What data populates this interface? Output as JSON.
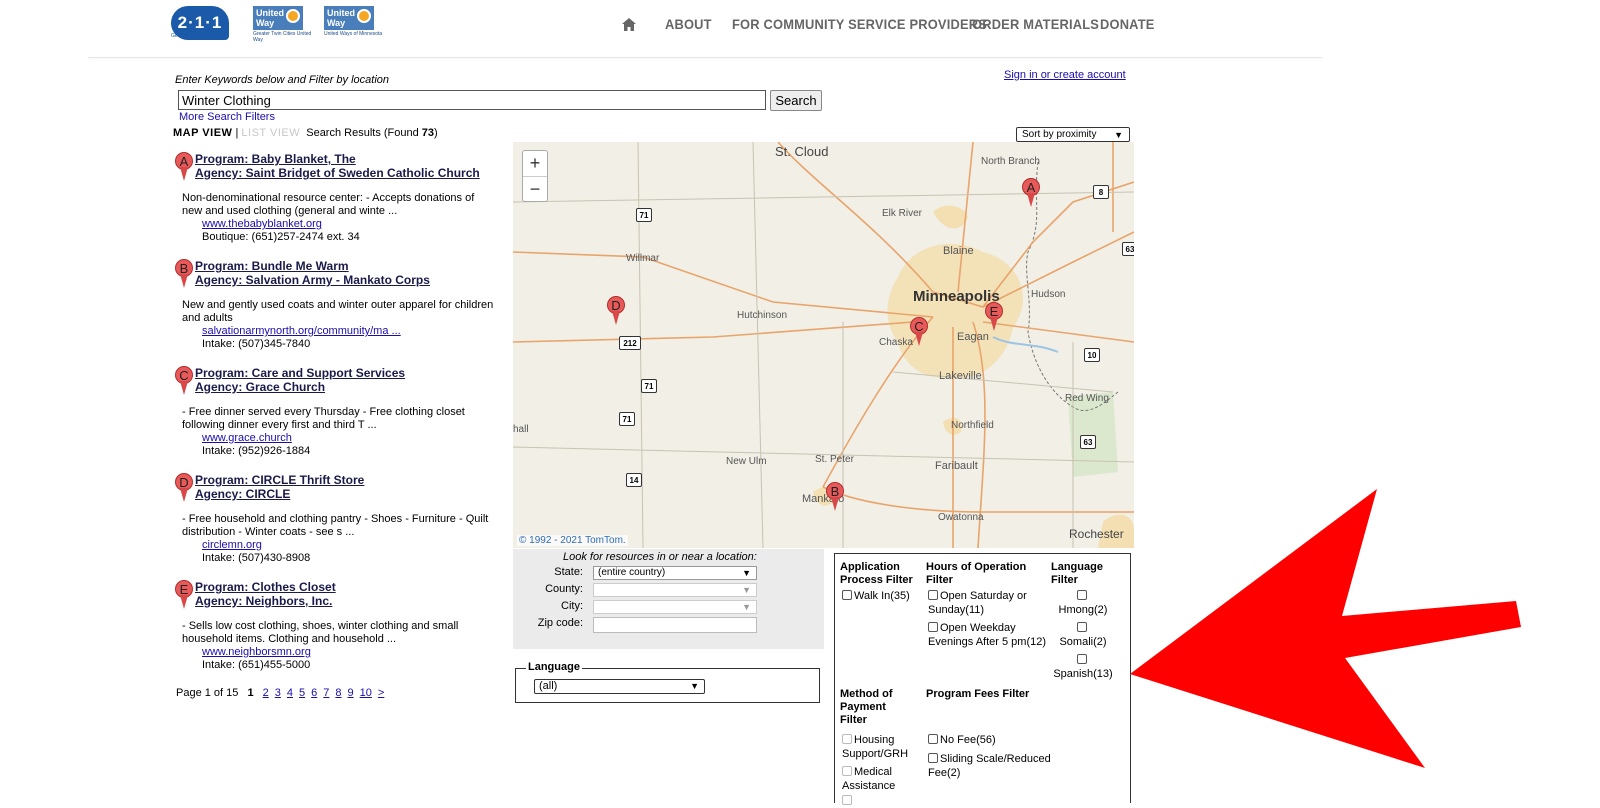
{
  "header": {
    "logo_211": "2·1·1",
    "logo_211_tagline": "Get Connected. Get Help.",
    "uw1_name": "United Way",
    "uw1_sub": "Greater Twin Cities United Way",
    "uw2_name": "United Way",
    "uw2_sub": "United Ways of Minnesota",
    "nav": [
      "ABOUT",
      "FOR COMMUNITY SERVICE PROVIDERS",
      "ORDER MATERIALS",
      "DONATE"
    ]
  },
  "search": {
    "label": "Enter Keywords below and Filter by location",
    "value": "Winter Clothing",
    "button": "Search",
    "more_filters": "More Search Filters",
    "signin": "Sign in or create account"
  },
  "viewbar": {
    "map_view": "MAP VIEW",
    "sep": "|",
    "list_view": "LIST VIEW",
    "results_prefix": "Search Results (Found ",
    "results_count": "73",
    "results_suffix": ")"
  },
  "sort": {
    "selected": "Sort by proximity"
  },
  "results": [
    {
      "letter": "A",
      "program": "Program: Baby Blanket, The",
      "agency": "Agency: Saint Bridget of Sweden Catholic Church",
      "desc": "Non-denominational resource center: - Accepts donations of new and used clothing (general and winte ...",
      "link": "www.thebabyblanket.org",
      "phone": "Boutique: (651)257-2474 ext. 34"
    },
    {
      "letter": "B",
      "program": "Program: Bundle Me Warm",
      "agency": "Agency: Salvation Army - Mankato Corps",
      "desc": "New and gently used coats and winter outer apparel for children and adults",
      "link": "salvationarmynorth.org/community/ma ...",
      "phone": "Intake: (507)345-7840"
    },
    {
      "letter": "C",
      "program": "Program: Care and Support Services",
      "agency": "Agency: Grace Church",
      "desc": "- Free dinner served every Thursday - Free clothing closet following dinner every first and third T ...",
      "link": "www.grace.church",
      "phone": "Intake: (952)926-1884"
    },
    {
      "letter": "D",
      "program": "Program: CIRCLE Thrift Store",
      "agency": "Agency: CIRCLE",
      "desc": "- Free household and clothing pantry - Shoes - Furniture - Quilt distribution - Winter coats - see s ...",
      "link": "circlemn.org",
      "phone": "Intake: (507)430-8908"
    },
    {
      "letter": "E",
      "program": "Program: Clothes Closet",
      "agency": "Agency: Neighbors, Inc.",
      "desc": "- Sells low cost clothing, shoes, winter clothing and small household items. Clothing and household ...",
      "link": "www.neighborsmn.org",
      "phone": "Intake: (651)455-5000"
    }
  ],
  "pager": {
    "label": "Page 1 of 15",
    "current": "1",
    "pages": [
      "2",
      "3",
      "4",
      "5",
      "6",
      "7",
      "8",
      "9",
      "10",
      ">"
    ]
  },
  "map": {
    "zoom_in": "+",
    "zoom_out": "−",
    "copyright": "© 1992 - 2021 TomTom.",
    "places": [
      "St. Cloud",
      "North Branch",
      "Elk River",
      "Blaine",
      "Willmar",
      "Hutchinson",
      "Minneapolis",
      "Hudson",
      "Chaska",
      "Eagan",
      "Lakeville",
      "Red Wing",
      "Northfield",
      "Faribault",
      "St. Peter",
      "New Ulm",
      "Mankato",
      "Owatonna",
      "Rochester",
      "hall"
    ],
    "shields": [
      "71",
      "8",
      "63",
      "212",
      "10",
      "71",
      "71",
      "14",
      "63"
    ],
    "pins": [
      "A",
      "B",
      "C",
      "D",
      "E"
    ]
  },
  "location": {
    "title": "Look for resources in or near a location:",
    "state_label": "State:",
    "state_value": "(entire country)",
    "county_label": "County:",
    "city_label": "City:",
    "zip_label": "Zip code:"
  },
  "language": {
    "legend": "Language",
    "value": "(all)"
  },
  "filters": {
    "app_head": "Application Process Filter",
    "hours_head": "Hours of Operation Filter",
    "lang_head": "Language Filter",
    "app_opts": [
      "Walk In(35)"
    ],
    "hours_opts": [
      "Open Saturday or Sunday(11)",
      "Open Weekday Evenings After 5 pm(12)"
    ],
    "lang_opts": [
      "Hmong(2)",
      "Somali(2)",
      "Spanish(13)"
    ],
    "pay_head": "Method of Payment Filter",
    "fees_head": "Program Fees Filter",
    "pay_opts": [
      "Housing Support/GRH",
      "Medical Assistance"
    ],
    "fees_opts": [
      "No Fee(56)",
      "Sliding Scale/Reduced Fee(2)"
    ]
  },
  "colors": {
    "arrow": "#ff0000",
    "pin": "#e85a5a",
    "link": "#1a0dab",
    "brand": "#1a5aa8"
  }
}
